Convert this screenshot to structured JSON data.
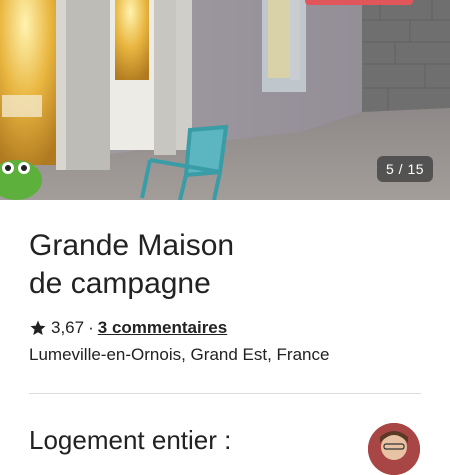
{
  "photo": {
    "counter": "5 / 15"
  },
  "listing": {
    "title_line1": "Grande Maison",
    "title_line2": "de campagne",
    "rating": "3,67",
    "separator": "·",
    "reviews_link": "3 commentaires",
    "location": "Lumeville-en-Ornois, Grand Est, France"
  },
  "host_section": {
    "heading": "Logement entier :"
  },
  "colors": {
    "text": "#222222",
    "divider": "#dddddd",
    "badge": "#e0565b"
  }
}
